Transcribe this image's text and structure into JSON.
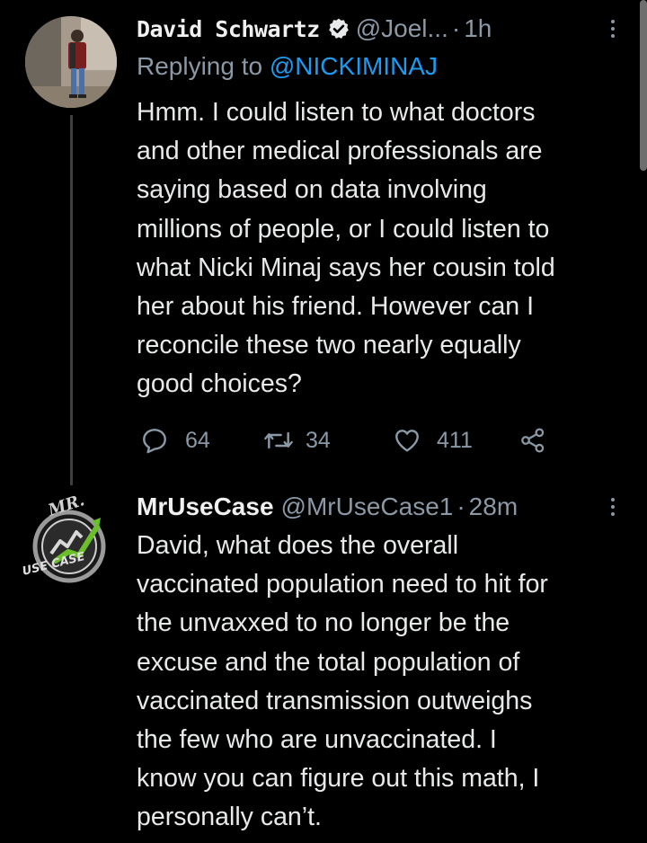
{
  "tweet1": {
    "display_name": "David Schwartz",
    "handle": "@Joel...",
    "separator": "·",
    "time": "1h",
    "replying_prefix": "Replying to",
    "replying_to": "@NICKIMINAJ",
    "lines": [
      "Hmm. I could listen to what doctors",
      "and other medical professionals are",
      "saying based on data involving",
      "millions of people, or I could listen to",
      "what Nicki Minaj says her cousin told",
      "her about his friend. However can I",
      "reconcile these two nearly equally",
      "good choices?"
    ],
    "replies": "64",
    "retweets": "34",
    "likes": "411"
  },
  "tweet2": {
    "display_name": "MrUseCase",
    "handle": "@MrUseCase1",
    "separator": "·",
    "time": "28m",
    "avatar_text_top": "MR.",
    "avatar_text_bottom": "USE CASE",
    "lines": [
      "David, what does the overall",
      "vaccinated population need to hit for",
      "the unvaxxed to no longer be the",
      "excuse and the total population of",
      "vaccinated transmission outweighs",
      "the few who are unvaccinated. I",
      "know you can figure out this math, I",
      "personally can’t."
    ]
  },
  "icons": {
    "verified": "verified-badge-icon",
    "reply": "reply-bubble-icon",
    "retweet": "retweet-icon",
    "like": "heart-icon",
    "share": "share-icon",
    "more": "more-vertical-icon"
  },
  "colors": {
    "background": "#000000",
    "text": "#e7e9ea",
    "secondary": "#8b98a5",
    "link": "#1d9bf0",
    "thread_line": "#3c4043"
  }
}
